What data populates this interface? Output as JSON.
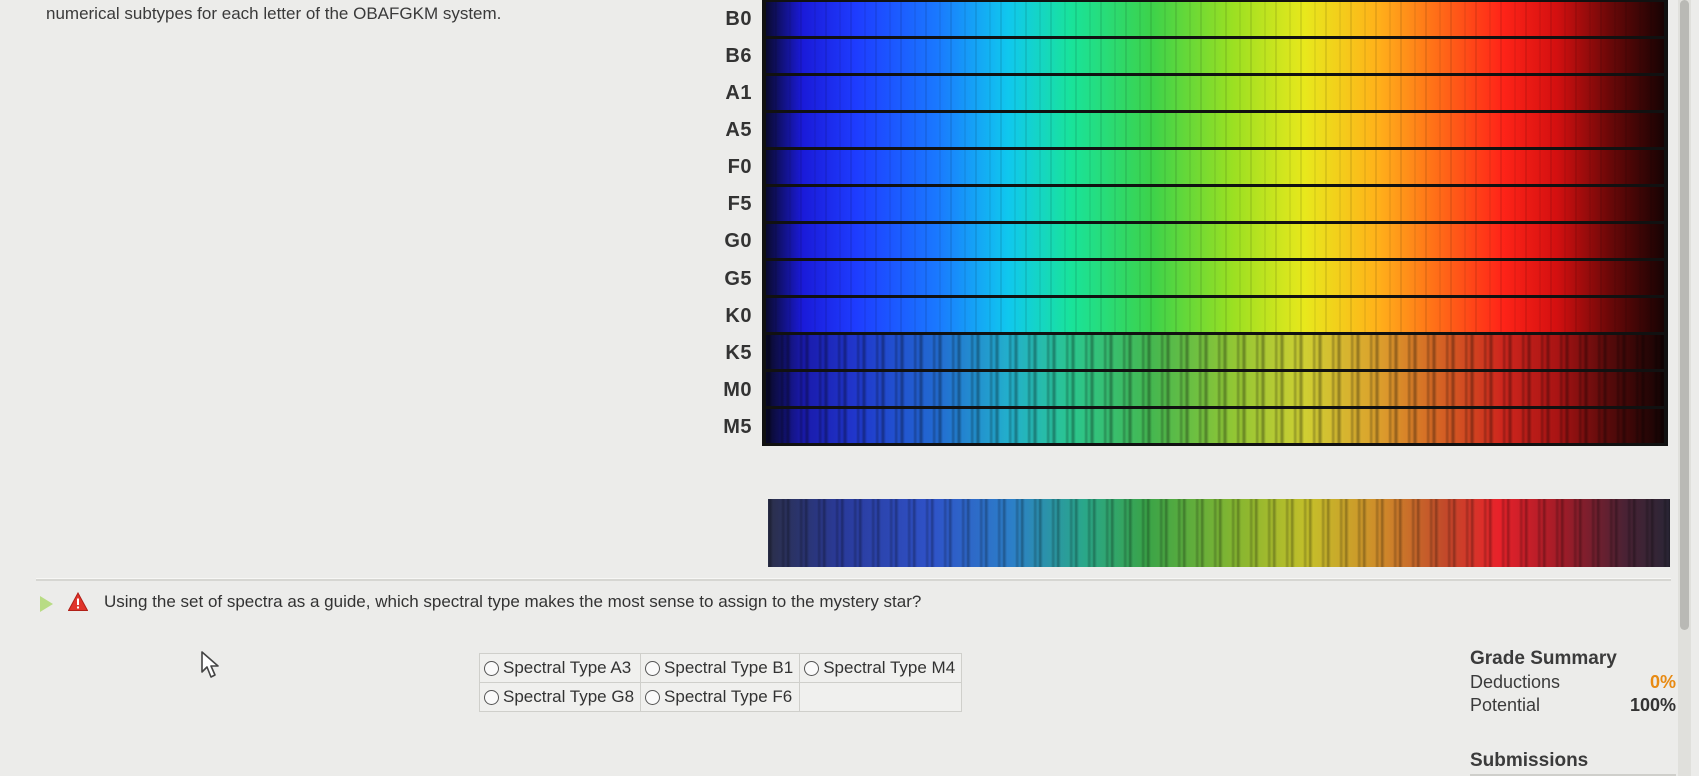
{
  "intro_text": "numerical subtypes for each letter of the OBAFGKM system.",
  "spectra": {
    "labels": [
      "B0",
      "B6",
      "A1",
      "A5",
      "F0",
      "F5",
      "G0",
      "G5",
      "K0",
      "K5",
      "M0",
      "M5"
    ]
  },
  "question": {
    "text": "Using the set of spectra as a guide, which spectral type makes the most sense to assign to the mystery star?",
    "options": [
      {
        "label": "Spectral Type A3"
      },
      {
        "label": "Spectral Type B1"
      },
      {
        "label": "Spectral Type M4"
      },
      {
        "label": "Spectral Type G8"
      },
      {
        "label": "Spectral Type F6"
      }
    ]
  },
  "grade_summary": {
    "title": "Grade Summary",
    "deductions_label": "Deductions",
    "deductions_value": "0%",
    "potential_label": "Potential",
    "potential_value": "100%"
  },
  "submissions_label": "Submissions",
  "colors": {
    "expand_arrow": "#b8dc84",
    "warning": "#e0342a",
    "deductions": "#e88a12"
  }
}
